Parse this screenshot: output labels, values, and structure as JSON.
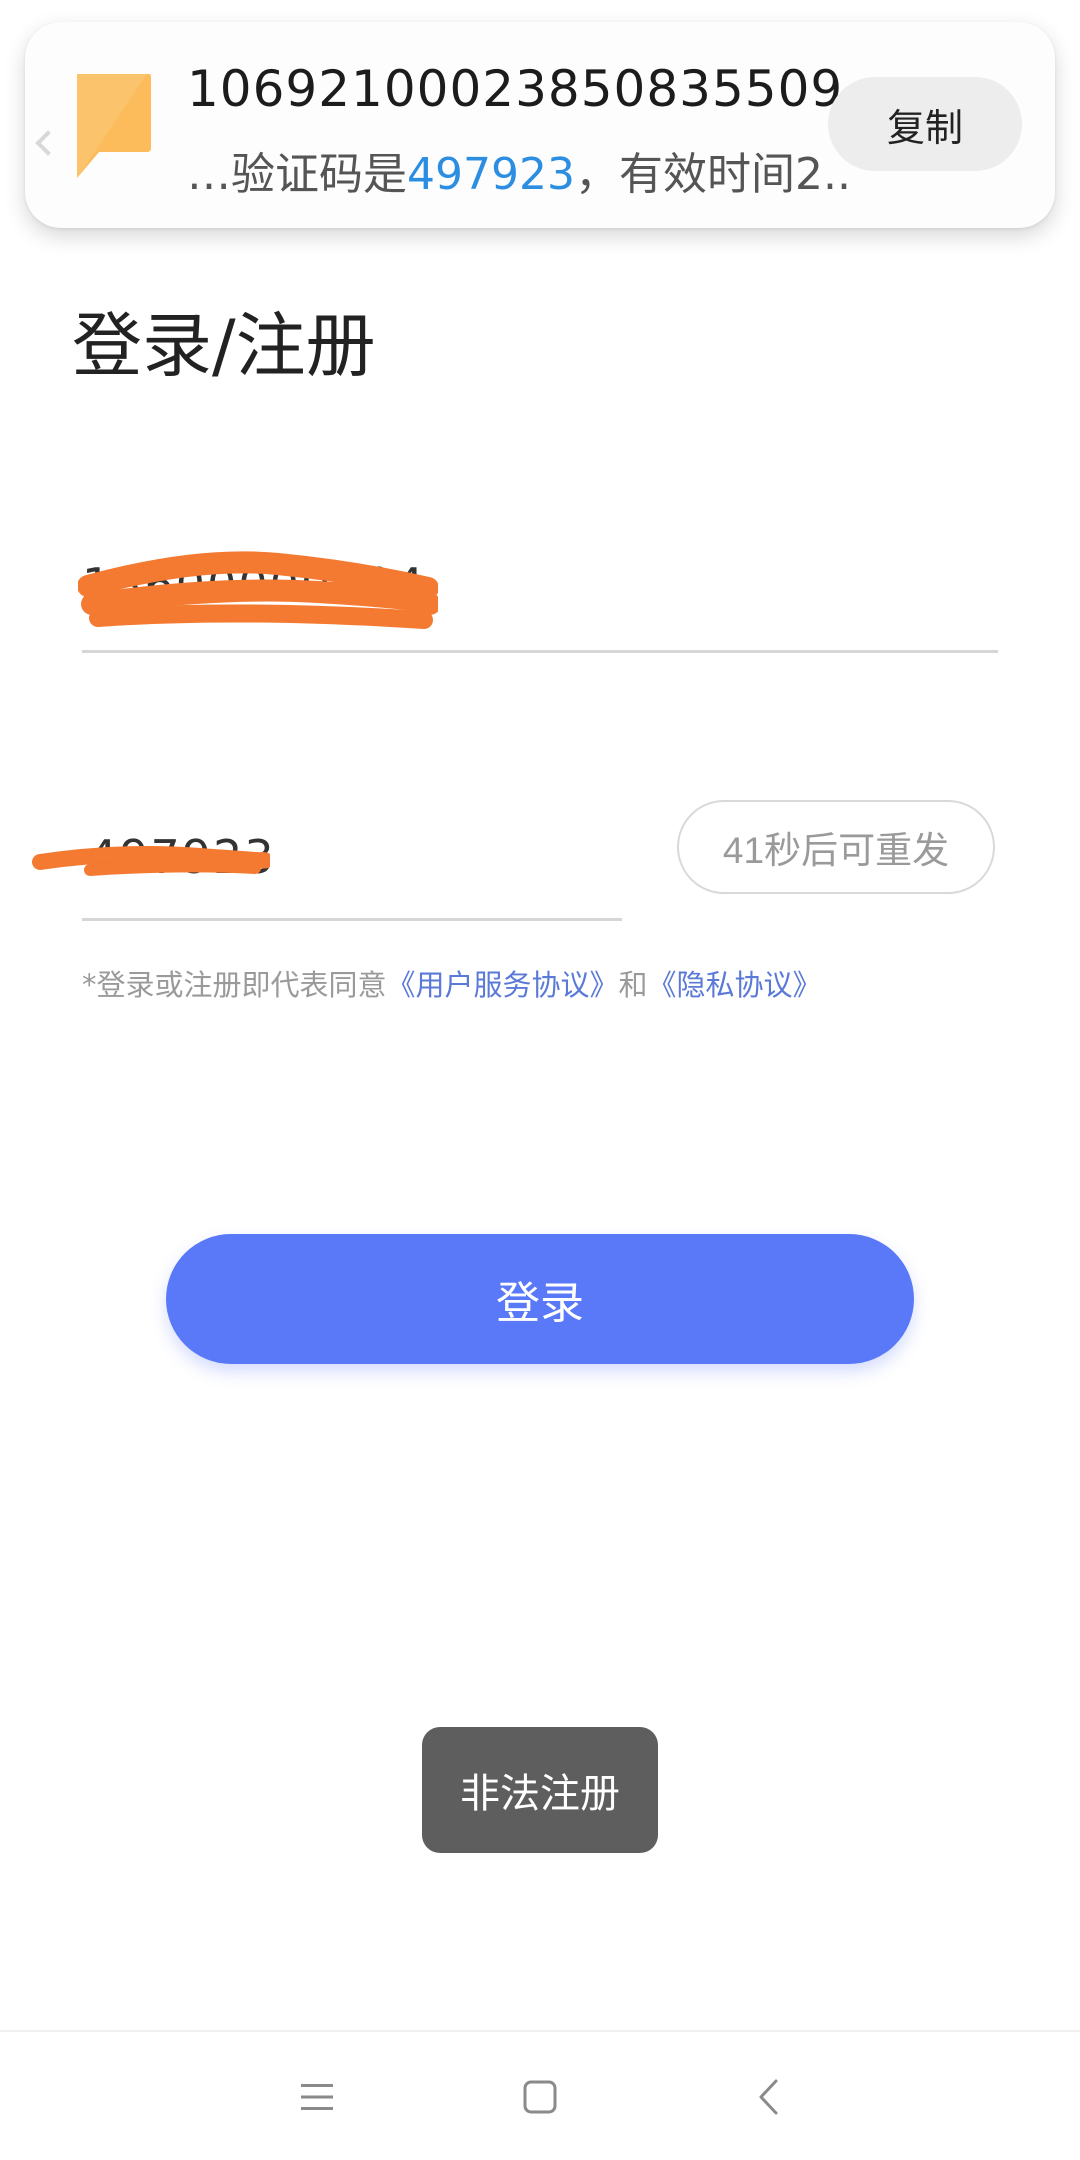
{
  "notification": {
    "sender": "10692100023850835509",
    "body_prefix": "…验证码是",
    "code": "497923",
    "body_suffix": "，有效时间2..",
    "copy_label": "复制"
  },
  "login": {
    "title": "登录/注册",
    "phone_value": "13600000004",
    "code_value": "497923",
    "resend_label": "41秒后可重发",
    "agreement": {
      "prefix": "*登录或注册即代表同意",
      "terms_link": "《用户服务协议》",
      "conjunction": "和",
      "privacy_link": "《隐私协议》"
    },
    "submit_label": "登录"
  },
  "toast": {
    "message": "非法注册"
  },
  "colors": {
    "primary": "#5a79f8",
    "link": "#5b7ad7",
    "code_highlight": "#2c8ee0",
    "redaction": "#f47a32",
    "toast_bg": "#5e5e5e"
  },
  "navbar": {
    "items": [
      "menu-icon",
      "home-icon",
      "back-icon"
    ]
  }
}
